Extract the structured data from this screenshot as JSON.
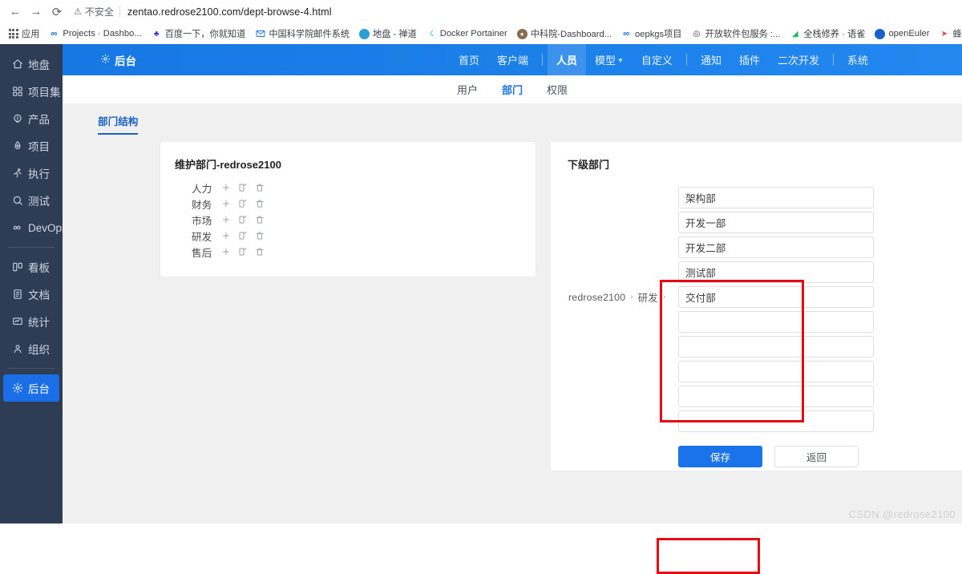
{
  "browser": {
    "back_icon": "back-arrow-icon",
    "forward_icon": "forward-arrow-icon",
    "reload_icon": "reload-icon",
    "security_icon": "warning-triangle-icon",
    "security_label": "不安全",
    "url": "zentao.redrose2100.com/dept-browse-4.html",
    "bookmarks": [
      {
        "label": "应用",
        "icon": "apps-grid-icon",
        "color": "#5f6368"
      },
      {
        "label": "Projects · Dashbo...",
        "icon": "infinity-icon",
        "color": "#1a73e8"
      },
      {
        "label": "百度一下，你就知道",
        "icon": "baidu-paw-icon",
        "color": "#2932e1"
      },
      {
        "label": "中国科学院邮件系统",
        "icon": "mail-icon",
        "color": "#1a73e8"
      },
      {
        "label": "地盘 - 禅道",
        "icon": "zentao-circle-icon",
        "color": "#2a9fd6"
      },
      {
        "label": "Docker Portainer",
        "icon": "portainer-whale-icon",
        "color": "#13bef9"
      },
      {
        "label": "中科院-Dashboard...",
        "icon": "avatar-icon",
        "color": "#8a6d4f"
      },
      {
        "label": "oepkgs项目",
        "icon": "infinity-icon",
        "color": "#1a73e8"
      },
      {
        "label": "开放软件包服务 :...",
        "icon": "openlogo-icon",
        "color": "#3b3b48"
      },
      {
        "label": "全栈修养 · 语雀",
        "icon": "yuque-leaf-icon",
        "color": "#25b864"
      },
      {
        "label": "openEuler",
        "icon": "openeuler-icon",
        "color": "#1a5fd0"
      },
      {
        "label": "蜂",
        "icon": "feather-icon",
        "color": "#d94a3d"
      }
    ]
  },
  "sidebar": {
    "items": [
      {
        "label": "地盘",
        "icon": "home-icon",
        "active": false
      },
      {
        "label": "项目集",
        "icon": "grid-blocks-icon",
        "active": false
      },
      {
        "label": "产品",
        "icon": "bulb-icon",
        "active": false
      },
      {
        "label": "项目",
        "icon": "rocket-drop-icon",
        "active": false
      },
      {
        "label": "执行",
        "icon": "running-person-icon",
        "active": false
      },
      {
        "label": "测试",
        "icon": "magnifier-icon",
        "active": false
      },
      {
        "label": "DevOps",
        "icon": "infinity-icon",
        "active": false
      },
      {
        "label": "看板",
        "icon": "kanban-icon",
        "active": false
      },
      {
        "label": "文档",
        "icon": "document-icon",
        "active": false
      },
      {
        "label": "统计",
        "icon": "chart-monitor-icon",
        "active": false
      },
      {
        "label": "组织",
        "icon": "users-icon",
        "active": false
      },
      {
        "label": "后台",
        "icon": "gear-icon",
        "active": true
      }
    ]
  },
  "topnav": {
    "brand_icon": "gear-icon",
    "brand_label": "后台",
    "items": [
      {
        "label": "首页",
        "current": false,
        "caret": false
      },
      {
        "label": "客户端",
        "current": false,
        "caret": false
      },
      {
        "label": "人员",
        "current": true,
        "caret": false
      },
      {
        "label": "模型",
        "current": false,
        "caret": true
      },
      {
        "label": "自定义",
        "current": false,
        "caret": false
      },
      {
        "label": "通知",
        "current": false,
        "caret": false
      },
      {
        "label": "插件",
        "current": false,
        "caret": false
      },
      {
        "label": "二次开发",
        "current": false,
        "caret": false
      },
      {
        "label": "系统",
        "current": false,
        "caret": false
      }
    ]
  },
  "subnav": {
    "items": [
      {
        "label": "用户",
        "active": false
      },
      {
        "label": "部门",
        "active": true
      },
      {
        "label": "权限",
        "active": false
      }
    ]
  },
  "tabstrip": {
    "tab_label": "部门结构"
  },
  "left_card": {
    "title": "维护部门-redrose2100",
    "row_icons": {
      "add": "plus-icon",
      "edit": "edit-square-icon",
      "delete": "trash-icon"
    },
    "departments": [
      {
        "name": "人力"
      },
      {
        "name": "财务"
      },
      {
        "name": "市场"
      },
      {
        "name": "研发"
      },
      {
        "name": "售后"
      }
    ]
  },
  "right_panel": {
    "title": "下级部门",
    "breadcrumb": {
      "root": "redrose2100",
      "node": "研发",
      "separator": "›"
    },
    "input_placeholder": "",
    "inputs": [
      {
        "value": "架构部"
      },
      {
        "value": "开发一部"
      },
      {
        "value": "开发二部"
      },
      {
        "value": "测试部"
      },
      {
        "value": "交付部"
      },
      {
        "value": ""
      },
      {
        "value": ""
      },
      {
        "value": ""
      },
      {
        "value": ""
      },
      {
        "value": ""
      }
    ],
    "buttons": {
      "save": "保存",
      "back": "返回"
    }
  },
  "annotations": {
    "color": "#e50914",
    "boxes": [
      {
        "name": "inputs-highlight"
      },
      {
        "name": "save-highlight"
      }
    ]
  },
  "watermark": "CSDN @redrose2100"
}
